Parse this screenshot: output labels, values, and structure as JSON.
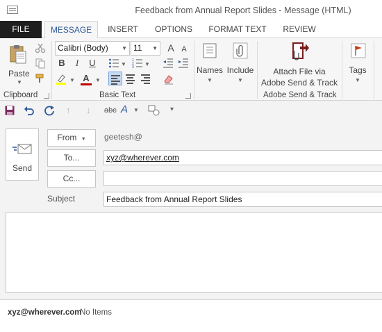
{
  "window": {
    "title": "Feedback from Annual Report Slides - Message (HTML)"
  },
  "tabs": [
    {
      "label": "FILE"
    },
    {
      "label": "MESSAGE"
    },
    {
      "label": "INSERT"
    },
    {
      "label": "OPTIONS"
    },
    {
      "label": "FORMAT TEXT"
    },
    {
      "label": "REVIEW"
    }
  ],
  "ribbon": {
    "clipboard": {
      "paste_label": "Paste",
      "group_label": "Clipboard"
    },
    "basic_text": {
      "font_name": "Calibri (Body)",
      "font_size": "11",
      "bold": "B",
      "italic": "I",
      "underline": "U",
      "grow_font": "A",
      "shrink_font": "A",
      "group_label": "Basic Text"
    },
    "names": {
      "label": "Names"
    },
    "include": {
      "label": "Include"
    },
    "adobe": {
      "label_line1": "Attach File via",
      "label_line2": "Adobe Send & Track",
      "group_label": "Adobe Send & Track"
    },
    "tags": {
      "label": "Tags"
    }
  },
  "qat": {
    "spelling_glyph": "abc"
  },
  "compose": {
    "send_label": "Send",
    "from_label": "From",
    "from_value": "geetesh@",
    "to_label": "To...",
    "to_value": "xyz@wherever.com",
    "cc_label": "Cc...",
    "cc_value": "",
    "subject_label": "Subject",
    "subject_value": "Feedback from Annual Report Slides"
  },
  "people_pane": {
    "email": "xyz@wherever.com",
    "status": "No Items"
  },
  "colors": {
    "accent": "#2b579a",
    "file_tab_bg": "#1e1e1e",
    "ribbon_bg": "#f6f6f6",
    "font_color_red": "#c00000",
    "highlight_yellow": "#ffff00",
    "align_active": "#c5daf2"
  }
}
